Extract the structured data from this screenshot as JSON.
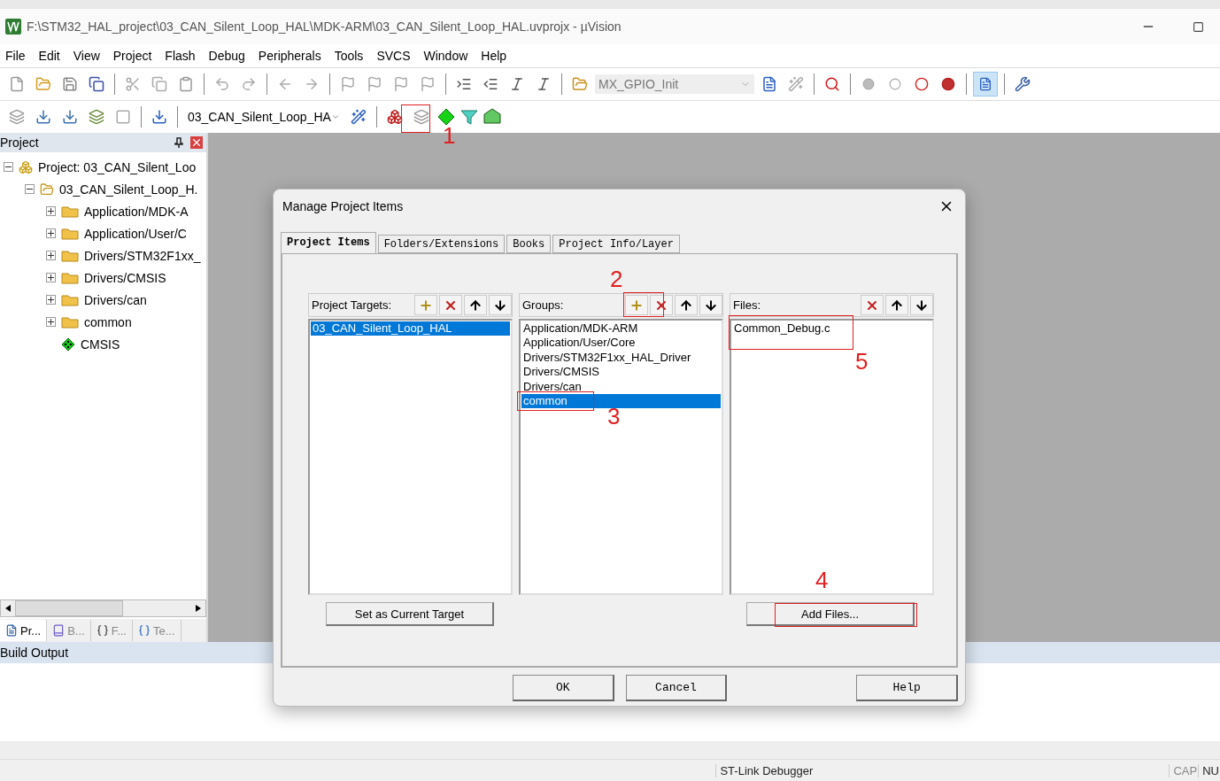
{
  "window": {
    "title": "F:\\STM32_HAL_project\\03_CAN_Silent_Loop_HAL\\MDK-ARM\\03_CAN_Silent_Loop_HAL.uvprojx - µVision"
  },
  "menu": [
    "File",
    "Edit",
    "View",
    "Project",
    "Flash",
    "Debug",
    "Peripherals",
    "Tools",
    "SVCS",
    "Window",
    "Help"
  ],
  "toolbar": {
    "function_combo": "MX_GPIO_Init"
  },
  "build_toolbar": {
    "target_combo": "03_CAN_Silent_Loop_HA"
  },
  "project_panel": {
    "title": "Project",
    "tree": [
      {
        "label": "Project: 03_CAN_Silent_Loo",
        "kind": "project",
        "expanded": true,
        "children": [
          {
            "label": "03_CAN_Silent_Loop_H.",
            "kind": "target",
            "expanded": true,
            "children": [
              {
                "label": "Application/MDK-A",
                "kind": "group",
                "expanded": false
              },
              {
                "label": "Application/User/C",
                "kind": "group",
                "expanded": false
              },
              {
                "label": "Drivers/STM32F1xx_",
                "kind": "group",
                "expanded": false
              },
              {
                "label": "Drivers/CMSIS",
                "kind": "group",
                "expanded": false
              },
              {
                "label": "Drivers/can",
                "kind": "group",
                "expanded": false
              },
              {
                "label": "common",
                "kind": "group",
                "expanded": false
              },
              {
                "label": "CMSIS",
                "kind": "component"
              }
            ]
          }
        ]
      }
    ],
    "tabs": [
      {
        "label": "Pr...",
        "kind": "project",
        "selected": true
      },
      {
        "label": "B...",
        "kind": "books",
        "selected": false
      },
      {
        "label": "F...",
        "kind": "functions",
        "selected": false
      },
      {
        "label": "Te...",
        "kind": "templates",
        "selected": false
      }
    ]
  },
  "build_output": {
    "title": "Build Output"
  },
  "status_bar": {
    "debugger": "ST-Link Debugger",
    "caps": "CAP",
    "num": "NU"
  },
  "dialog": {
    "title": "Manage Project Items",
    "tabs": [
      {
        "label": "Project Items",
        "selected": true
      },
      {
        "label": "Folders/Extensions",
        "selected": false
      },
      {
        "label": "Books",
        "selected": false
      },
      {
        "label": "Project Info/Layer",
        "selected": false
      }
    ],
    "targets": {
      "label": "Project Targets:",
      "items": [
        {
          "label": "03_CAN_Silent_Loop_HAL",
          "selected": true
        }
      ]
    },
    "groups": {
      "label": "Groups:",
      "items": [
        {
          "label": "Application/MDK-ARM",
          "selected": false
        },
        {
          "label": "Application/User/Core",
          "selected": false
        },
        {
          "label": "Drivers/STM32F1xx_HAL_Driver",
          "selected": false
        },
        {
          "label": "Drivers/CMSIS",
          "selected": false
        },
        {
          "label": "Drivers/can",
          "selected": false
        },
        {
          "label": "common",
          "selected": true
        }
      ]
    },
    "files": {
      "label": "Files:",
      "items": [
        {
          "label": "Common_Debug.c",
          "selected": false
        }
      ]
    },
    "set_target_button": "Set as Current Target",
    "add_files_button": "Add Files...",
    "buttons": [
      "OK",
      "Cancel",
      "Help"
    ]
  },
  "annotations": [
    "1",
    "2",
    "3",
    "4",
    "5"
  ]
}
